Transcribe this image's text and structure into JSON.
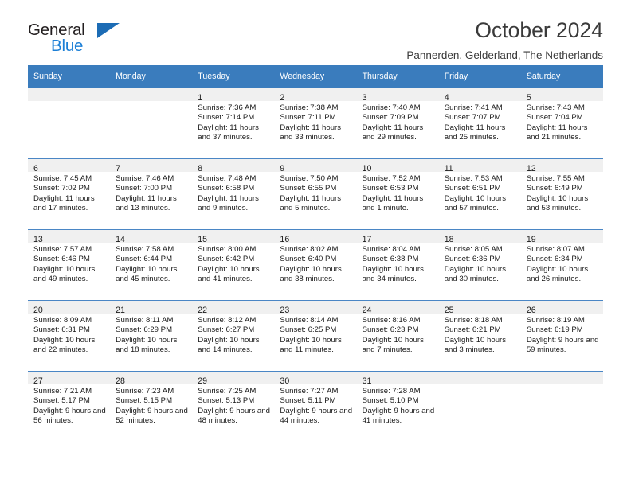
{
  "brand": {
    "name_top": "General",
    "name_bottom": "Blue",
    "accent_color": "#1c7fd6",
    "triangle_color": "#1c6cb5"
  },
  "header": {
    "title": "October 2024",
    "subtitle": "Pannerden, Gelderland, The Netherlands"
  },
  "calendar": {
    "header_bg": "#3a7cbd",
    "weekday_headers": [
      "Sunday",
      "Monday",
      "Tuesday",
      "Wednesday",
      "Thursday",
      "Friday",
      "Saturday"
    ],
    "labels": {
      "sunrise": "Sunrise:",
      "sunset": "Sunset:",
      "daylight": "Daylight:"
    },
    "weeks": [
      [
        {
          "day": "",
          "sunrise": "",
          "sunset": "",
          "daylight": ""
        },
        {
          "day": "",
          "sunrise": "",
          "sunset": "",
          "daylight": ""
        },
        {
          "day": "1",
          "sunrise": "Sunrise: 7:36 AM",
          "sunset": "Sunset: 7:14 PM",
          "daylight": "Daylight: 11 hours and 37 minutes."
        },
        {
          "day": "2",
          "sunrise": "Sunrise: 7:38 AM",
          "sunset": "Sunset: 7:11 PM",
          "daylight": "Daylight: 11 hours and 33 minutes."
        },
        {
          "day": "3",
          "sunrise": "Sunrise: 7:40 AM",
          "sunset": "Sunset: 7:09 PM",
          "daylight": "Daylight: 11 hours and 29 minutes."
        },
        {
          "day": "4",
          "sunrise": "Sunrise: 7:41 AM",
          "sunset": "Sunset: 7:07 PM",
          "daylight": "Daylight: 11 hours and 25 minutes."
        },
        {
          "day": "5",
          "sunrise": "Sunrise: 7:43 AM",
          "sunset": "Sunset: 7:04 PM",
          "daylight": "Daylight: 11 hours and 21 minutes."
        }
      ],
      [
        {
          "day": "6",
          "sunrise": "Sunrise: 7:45 AM",
          "sunset": "Sunset: 7:02 PM",
          "daylight": "Daylight: 11 hours and 17 minutes."
        },
        {
          "day": "7",
          "sunrise": "Sunrise: 7:46 AM",
          "sunset": "Sunset: 7:00 PM",
          "daylight": "Daylight: 11 hours and 13 minutes."
        },
        {
          "day": "8",
          "sunrise": "Sunrise: 7:48 AM",
          "sunset": "Sunset: 6:58 PM",
          "daylight": "Daylight: 11 hours and 9 minutes."
        },
        {
          "day": "9",
          "sunrise": "Sunrise: 7:50 AM",
          "sunset": "Sunset: 6:55 PM",
          "daylight": "Daylight: 11 hours and 5 minutes."
        },
        {
          "day": "10",
          "sunrise": "Sunrise: 7:52 AM",
          "sunset": "Sunset: 6:53 PM",
          "daylight": "Daylight: 11 hours and 1 minute."
        },
        {
          "day": "11",
          "sunrise": "Sunrise: 7:53 AM",
          "sunset": "Sunset: 6:51 PM",
          "daylight": "Daylight: 10 hours and 57 minutes."
        },
        {
          "day": "12",
          "sunrise": "Sunrise: 7:55 AM",
          "sunset": "Sunset: 6:49 PM",
          "daylight": "Daylight: 10 hours and 53 minutes."
        }
      ],
      [
        {
          "day": "13",
          "sunrise": "Sunrise: 7:57 AM",
          "sunset": "Sunset: 6:46 PM",
          "daylight": "Daylight: 10 hours and 49 minutes."
        },
        {
          "day": "14",
          "sunrise": "Sunrise: 7:58 AM",
          "sunset": "Sunset: 6:44 PM",
          "daylight": "Daylight: 10 hours and 45 minutes."
        },
        {
          "day": "15",
          "sunrise": "Sunrise: 8:00 AM",
          "sunset": "Sunset: 6:42 PM",
          "daylight": "Daylight: 10 hours and 41 minutes."
        },
        {
          "day": "16",
          "sunrise": "Sunrise: 8:02 AM",
          "sunset": "Sunset: 6:40 PM",
          "daylight": "Daylight: 10 hours and 38 minutes."
        },
        {
          "day": "17",
          "sunrise": "Sunrise: 8:04 AM",
          "sunset": "Sunset: 6:38 PM",
          "daylight": "Daylight: 10 hours and 34 minutes."
        },
        {
          "day": "18",
          "sunrise": "Sunrise: 8:05 AM",
          "sunset": "Sunset: 6:36 PM",
          "daylight": "Daylight: 10 hours and 30 minutes."
        },
        {
          "day": "19",
          "sunrise": "Sunrise: 8:07 AM",
          "sunset": "Sunset: 6:34 PM",
          "daylight": "Daylight: 10 hours and 26 minutes."
        }
      ],
      [
        {
          "day": "20",
          "sunrise": "Sunrise: 8:09 AM",
          "sunset": "Sunset: 6:31 PM",
          "daylight": "Daylight: 10 hours and 22 minutes."
        },
        {
          "day": "21",
          "sunrise": "Sunrise: 8:11 AM",
          "sunset": "Sunset: 6:29 PM",
          "daylight": "Daylight: 10 hours and 18 minutes."
        },
        {
          "day": "22",
          "sunrise": "Sunrise: 8:12 AM",
          "sunset": "Sunset: 6:27 PM",
          "daylight": "Daylight: 10 hours and 14 minutes."
        },
        {
          "day": "23",
          "sunrise": "Sunrise: 8:14 AM",
          "sunset": "Sunset: 6:25 PM",
          "daylight": "Daylight: 10 hours and 11 minutes."
        },
        {
          "day": "24",
          "sunrise": "Sunrise: 8:16 AM",
          "sunset": "Sunset: 6:23 PM",
          "daylight": "Daylight: 10 hours and 7 minutes."
        },
        {
          "day": "25",
          "sunrise": "Sunrise: 8:18 AM",
          "sunset": "Sunset: 6:21 PM",
          "daylight": "Daylight: 10 hours and 3 minutes."
        },
        {
          "day": "26",
          "sunrise": "Sunrise: 8:19 AM",
          "sunset": "Sunset: 6:19 PM",
          "daylight": "Daylight: 9 hours and 59 minutes."
        }
      ],
      [
        {
          "day": "27",
          "sunrise": "Sunrise: 7:21 AM",
          "sunset": "Sunset: 5:17 PM",
          "daylight": "Daylight: 9 hours and 56 minutes."
        },
        {
          "day": "28",
          "sunrise": "Sunrise: 7:23 AM",
          "sunset": "Sunset: 5:15 PM",
          "daylight": "Daylight: 9 hours and 52 minutes."
        },
        {
          "day": "29",
          "sunrise": "Sunrise: 7:25 AM",
          "sunset": "Sunset: 5:13 PM",
          "daylight": "Daylight: 9 hours and 48 minutes."
        },
        {
          "day": "30",
          "sunrise": "Sunrise: 7:27 AM",
          "sunset": "Sunset: 5:11 PM",
          "daylight": "Daylight: 9 hours and 44 minutes."
        },
        {
          "day": "31",
          "sunrise": "Sunrise: 7:28 AM",
          "sunset": "Sunset: 5:10 PM",
          "daylight": "Daylight: 9 hours and 41 minutes."
        },
        {
          "day": "",
          "sunrise": "",
          "sunset": "",
          "daylight": ""
        },
        {
          "day": "",
          "sunrise": "",
          "sunset": "",
          "daylight": ""
        }
      ]
    ]
  }
}
